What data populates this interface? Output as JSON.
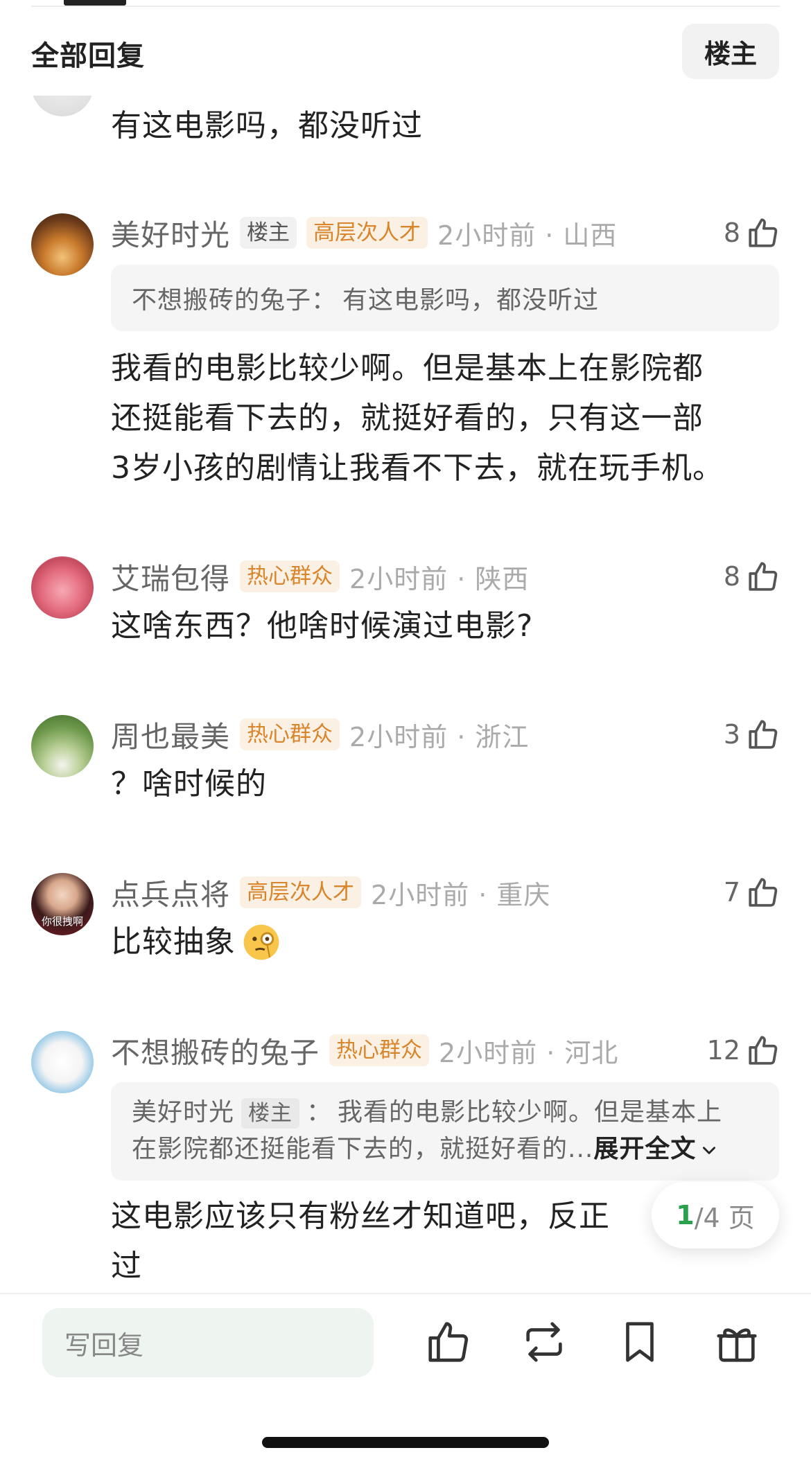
{
  "header": {
    "title": "全部回复",
    "op_filter": "楼主"
  },
  "partial_comment": {
    "text": "有这电影吗，都没听过"
  },
  "comments": [
    {
      "username": "美好时光",
      "op_badge": "楼主",
      "level_badge": "高层次人才",
      "time": "2小时前 · 山西",
      "likes": "8",
      "quote": {
        "user": "不想搬砖的兔子",
        "sep": "：",
        "text": "有这电影吗，都没听过"
      },
      "lines": [
        "我看的电影比较少啊。但是基本上在影院都",
        "还挺能看下去的，就挺好看的，只有这一部",
        "3岁小孩的剧情让我看不下去，就在玩手机。"
      ]
    },
    {
      "username": "艾瑞包得",
      "level_badge": "热心群众",
      "time": "2小时前 · 陕西",
      "likes": "8",
      "text": "这啥东西？他啥时候演过电影?"
    },
    {
      "username": "周也最美",
      "level_badge": "热心群众",
      "time": "2小时前 · 浙江",
      "likes": "3",
      "text": "？啥时候的"
    },
    {
      "username": "点兵点将",
      "level_badge": "高层次人才",
      "time": "2小时前 · 重庆",
      "likes": "7",
      "text": "比较抽象",
      "avatar_caption": "你很拽啊"
    },
    {
      "username": "不想搬砖的兔子",
      "level_badge": "热心群众",
      "time": "2小时前 · 河北",
      "likes": "12",
      "quote": {
        "user": "美好时光",
        "op_badge": "楼主",
        "sep": "：",
        "line1": "我看的电影比较少啊。但是基本上",
        "line2": "在影院都还挺能看下去的，就挺好看的...",
        "expand": "展开全文"
      },
      "line1": "这电影应该只有粉丝才知道吧，反正",
      "line2": "过"
    }
  ],
  "pager": {
    "current": "1",
    "total": "/4 页"
  },
  "bottom_bar": {
    "reply_placeholder": "写回复"
  },
  "colors": {
    "accent_green": "#2aa14b",
    "level_badge_text": "#d9852b",
    "level_badge_bg": "#fbf0e4"
  }
}
